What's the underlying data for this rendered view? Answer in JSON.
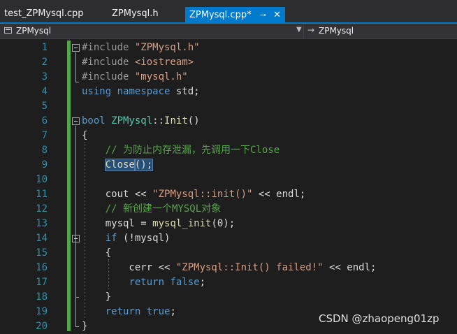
{
  "tabs": [
    {
      "label": "test_ZPMysql.cpp",
      "active": false
    },
    {
      "label": "ZPMysql.h",
      "active": false
    },
    {
      "label": "ZPMysql.cpp*",
      "active": true,
      "pin_icon": "pin-icon",
      "close_icon": "close-icon"
    }
  ],
  "navbar": {
    "scope_left": "ZPMysql",
    "scope_left_icon": "class-icon",
    "dropdown_icon": "dropdown-arrow-icon",
    "scope_right": "ZPMysql",
    "scope_right_icon": "method-arrow-icon"
  },
  "editor": {
    "line_numbers": [
      "1",
      "2",
      "3",
      "4",
      "5",
      "6",
      "7",
      "8",
      "9",
      "10",
      "11",
      "12",
      "13",
      "14",
      "15",
      "16",
      "17",
      "18",
      "19",
      "20"
    ],
    "lines": {
      "l1": [
        "#include ",
        "\"ZPMysql.h\""
      ],
      "l2": [
        "#include ",
        "<iostream>"
      ],
      "l3": [
        "#include ",
        "\"mysql.h\""
      ],
      "l4": [
        "using",
        " ",
        "namespace",
        " std;"
      ],
      "l6": [
        "bool",
        " ",
        "ZPMysql",
        "::",
        "Init",
        "()"
      ],
      "l7": [
        "{"
      ],
      "l8": [
        "    // 为防止内存泄漏，先调用一下Close"
      ],
      "l9": [
        "    ",
        "Close",
        "();"
      ],
      "l11": [
        "    cout << ",
        "\"ZPMysql::init()\"",
        " << endl;"
      ],
      "l12": [
        "    // 新创建一个MYSQL对象"
      ],
      "l13": [
        "    mysql = ",
        "mysql_init",
        "(0);"
      ],
      "l14": [
        "    ",
        "if",
        " (!mysql)"
      ],
      "l15": [
        "    {"
      ],
      "l16": [
        "        cerr << ",
        "\"ZPMysql::Init() failed!\"",
        " << endl;"
      ],
      "l17": [
        "        ",
        "return",
        " ",
        "false",
        ";"
      ],
      "l18": [
        "    }"
      ],
      "l19": [
        "    ",
        "return",
        " ",
        "true",
        ";"
      ],
      "l20": [
        "}"
      ]
    }
  },
  "watermark": "CSDN @zhaopeng01zp",
  "colors": {
    "accent": "#007acc",
    "background": "#1e1e1e",
    "keyword": "#569cd6",
    "string": "#d69d85",
    "comment": "#57a64a",
    "type": "#4ec9b0",
    "function": "#dcdcaa",
    "line_number": "#2b91af",
    "selection": "#264f78"
  }
}
